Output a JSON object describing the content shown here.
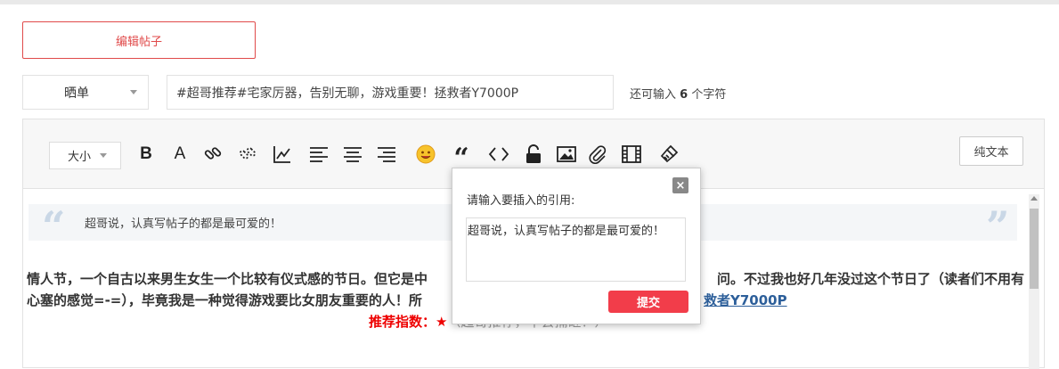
{
  "header": {
    "edit_post_label": "编辑帖子"
  },
  "form": {
    "category_value": "晒单",
    "title_value": "#超哥推荐#宅家厉器，告别无聊，游戏重要！拯救者Y7000P",
    "char_count_prefix": "还可输入",
    "char_count_value": "6",
    "char_count_suffix": "个字符"
  },
  "toolbar": {
    "size_label": "大小",
    "plain_text_label": "纯文本",
    "icons": [
      "bold-icon",
      "font-color-icon",
      "link-icon",
      "unlink-icon",
      "chart-icon",
      "align-left-icon",
      "align-center-icon",
      "align-right-icon",
      "emoji-icon",
      "quote-icon",
      "code-icon",
      "lock-icon",
      "image-icon",
      "attachment-icon",
      "video-icon",
      "format-brush-icon"
    ]
  },
  "content": {
    "quote_text": "超哥说，认真写帖子的都是最可爱的！",
    "para_line1_start": "情人节，一个自古以来男生女生一个比较有仪式感的节日。但它是中",
    "para_line1_end": "问。不过我也好几年没过这个节日了（读者们不用有",
    "para_line2_start": "心塞的感觉=-=），毕竟我是一种觉得游戏要比女朋友重要的人！所",
    "para_link": "救者Y7000P",
    "rec_label": "推荐指数：",
    "rec_star": "★",
    "rec_tail": "（超哥推荐，千会捕砸！）"
  },
  "dialog": {
    "label": "请输入要插入的引用:",
    "textarea_value": "超哥说，认真写帖子的都是最可爱的！",
    "submit_label": "提交",
    "close_label": "×"
  },
  "colors": {
    "accent": "#e04a4a",
    "submit": "#f23d4a",
    "link": "#2d5f9a"
  }
}
